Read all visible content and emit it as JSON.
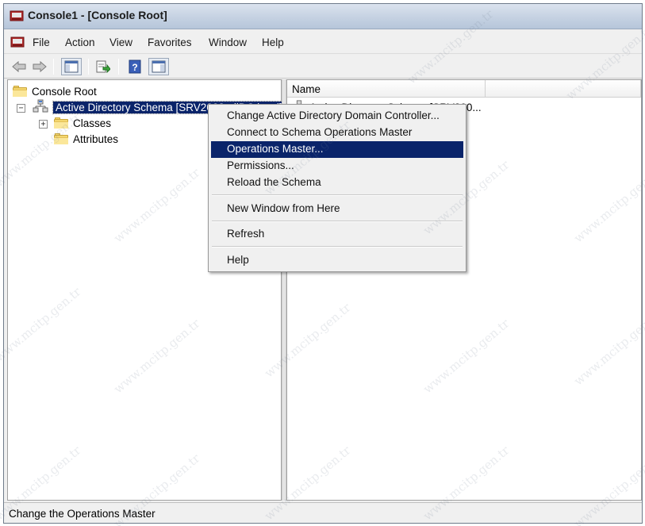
{
  "window": {
    "title": "Console1 - [Console Root]"
  },
  "menubar": {
    "items": [
      "File",
      "Action",
      "View",
      "Favorites",
      "Window",
      "Help"
    ]
  },
  "toolbar": {
    "buttons": [
      "back-arrow-icon",
      "forward-arrow-icon",
      "show-hide-console-tree-icon",
      "export-list-icon",
      "help-icon",
      "show-hide-action-pane-icon"
    ]
  },
  "tree": {
    "root": "Console Root",
    "schema": "Active Directory Schema [SRV2003-aliDC.local]",
    "children": [
      "Classes",
      "Attributes"
    ]
  },
  "list": {
    "columns": [
      "Name",
      ""
    ],
    "rows": [
      "Active Directory Schema [SRV200..."
    ]
  },
  "context_menu": {
    "groups": [
      [
        "Change Active Directory Domain Controller...",
        "Connect to Schema Operations Master",
        "Operations Master...",
        "Permissions...",
        "Reload the Schema"
      ],
      [
        "New Window from Here"
      ],
      [
        "Refresh"
      ],
      [
        "Help"
      ]
    ],
    "highlighted": "Operations Master..."
  },
  "statusbar": {
    "text": "Change the Operations Master"
  },
  "watermark": {
    "text": "www.mcitp.gen.tr"
  }
}
